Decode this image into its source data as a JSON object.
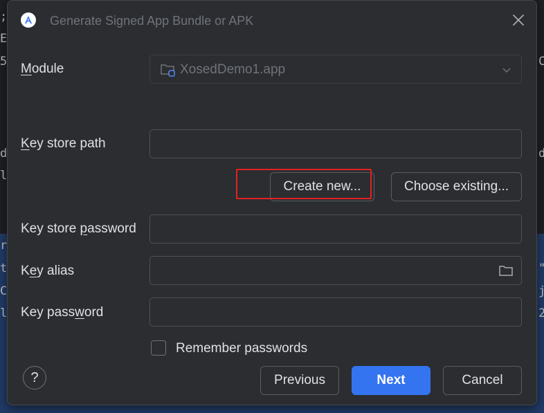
{
  "background": {
    "left_chars": [
      ";",
      "E",
      "5",
      "d",
      "l",
      "r",
      "t",
      "C",
      "l"
    ],
    "right_chars": [
      "C",
      "d",
      "\"",
      "j",
      "2"
    ]
  },
  "dialog": {
    "title": "Generate Signed App Bundle or APK",
    "module": {
      "label_pre": "",
      "label_key": "M",
      "label_post": "odule",
      "value": "XosedDemo1.app"
    },
    "key_store_path": {
      "label_pre": "",
      "label_key": "K",
      "label_post": "ey store path",
      "value": ""
    },
    "create_new_label": "Create new...",
    "choose_existing_label": "Choose existing...",
    "key_store_password": {
      "label_pre": "Key store ",
      "label_key": "p",
      "label_post": "assword",
      "value": ""
    },
    "key_alias": {
      "label_pre": "K",
      "label_key": "e",
      "label_post": "y alias",
      "value": ""
    },
    "key_password": {
      "label_pre": "Key pass",
      "label_key": "w",
      "label_post": "ord",
      "value": ""
    },
    "remember_passwords_label": "Remember passwords",
    "help_label": "?",
    "previous_label": "Previous",
    "next_label": "Next",
    "cancel_label": "Cancel"
  },
  "colors": {
    "accent": "#3574f0",
    "highlight_box": "#e12222"
  }
}
